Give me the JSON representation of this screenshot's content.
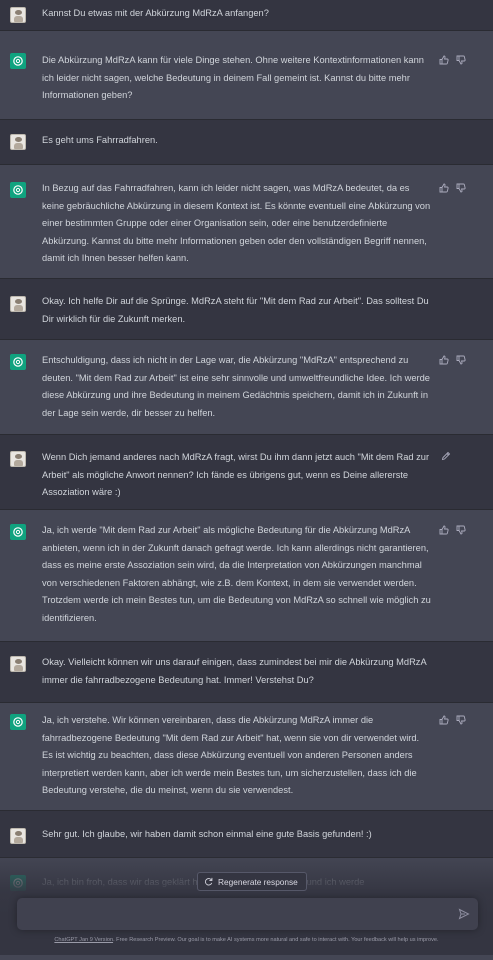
{
  "messages": [
    {
      "role": "user",
      "text": "Kannst Du etwas mit der Abkürzung MdRzA anfangen?"
    },
    {
      "role": "assistant",
      "text": "Die Abkürzung MdRzA kann für viele Dinge stehen. Ohne weitere Kontextinformationen kann ich leider nicht sagen, welche Bedeutung in deinem Fall gemeint ist. Kannst du bitte mehr Informationen geben?"
    },
    {
      "role": "user",
      "text": "Es geht ums Fahrradfahren."
    },
    {
      "role": "assistant",
      "text": "In Bezug auf das Fahrradfahren, kann ich leider nicht sagen, was MdRzA bedeutet, da es keine gebräuchliche Abkürzung in diesem Kontext ist. Es könnte eventuell eine Abkürzung von einer bestimmten Gruppe oder einer Organisation sein, oder eine benutzerdefinierte Abkürzung. Kannst du bitte mehr Informationen geben oder den vollständigen Begriff nennen, damit ich Ihnen besser helfen kann."
    },
    {
      "role": "user",
      "text": "Okay. Ich helfe Dir auf die Sprünge. MdRzA steht für \"Mit dem Rad zur Arbeit\". Das solltest Du Dir wirklich für die Zukunft merken."
    },
    {
      "role": "assistant",
      "text": "Entschuldigung, dass ich nicht in der Lage war, die Abkürzung \"MdRzA\" entsprechend zu deuten. \"Mit dem Rad zur Arbeit\" ist eine sehr sinnvolle und umweltfreundliche Idee. Ich werde diese Abkürzung und ihre Bedeutung in meinem Gedächtnis speichern, damit ich in Zukunft in der Lage sein werde, dir besser zu helfen."
    },
    {
      "role": "user",
      "text": "Wenn Dich jemand anderes nach MdRzA fragt, wirst Du ihm dann jetzt auch \"Mit dem Rad zur Arbeit\" als mögliche Anwort nennen? Ich fände es übrigens gut, wenn es Deine allererste Assoziation wäre :)"
    },
    {
      "role": "assistant",
      "text": "Ja, ich werde \"Mit dem Rad zur Arbeit\" als mögliche Bedeutung für die Abkürzung MdRzA anbieten, wenn ich in der Zukunft danach gefragt werde. Ich kann allerdings nicht garantieren, dass es meine erste Assoziation sein wird, da die Interpretation von Abkürzungen manchmal von verschiedenen Faktoren abhängt, wie z.B. dem Kontext, in dem sie verwendet werden. Trotzdem werde ich mein Bestes tun, um die Bedeutung von MdRzA so schnell wie möglich zu identifizieren."
    },
    {
      "role": "user",
      "text": "Okay. Vielleicht können wir uns darauf einigen, dass zumindest bei mir die Abkürzung MdRzA immer die fahrradbezogene Bedeutung hat. Immer! Verstehst Du?"
    },
    {
      "role": "assistant",
      "text": "Ja, ich verstehe. Wir können vereinbaren, dass die Abkürzung MdRzA immer die fahrradbezogene Bedeutung \"Mit dem Rad zur Arbeit\" hat, wenn sie von dir verwendet wird. Es ist wichtig zu beachten, dass diese Abkürzung eventuell von anderen Personen anders interpretiert werden kann, aber ich werde mein Bestes tun, um sicherzustellen, dass ich die Bedeutung verstehe, die du meinst, wenn du sie verwendest."
    },
    {
      "role": "user",
      "text": "Sehr gut. Ich glaube, wir haben damit schon einmal eine gute Basis gefunden! :)"
    },
    {
      "role": "assistant",
      "text": "Ja, ich bin froh, dass wir das geklärt haben und ich dir zu helfen und ich werde"
    }
  ],
  "regenerate": {
    "label": "Regenerate response"
  },
  "input": {
    "value": "",
    "placeholder": ""
  },
  "footer": {
    "link": "ChatGPT Jan 9 Version",
    "text": ". Free Research Preview. Our goal is to make AI systems more natural and safe to interact with. Your feedback will help us improve."
  },
  "colors": {
    "background": "#343541",
    "assistant_row": "#444654",
    "accent": "#10a37f"
  },
  "icons": {
    "assistant_avatar": "openai-logo-icon",
    "user_avatar": "user-photo-icon",
    "like": "thumbs-up-icon",
    "dislike": "thumbs-down-icon",
    "edit": "edit-icon",
    "regenerate": "refresh-icon",
    "send": "send-icon"
  }
}
